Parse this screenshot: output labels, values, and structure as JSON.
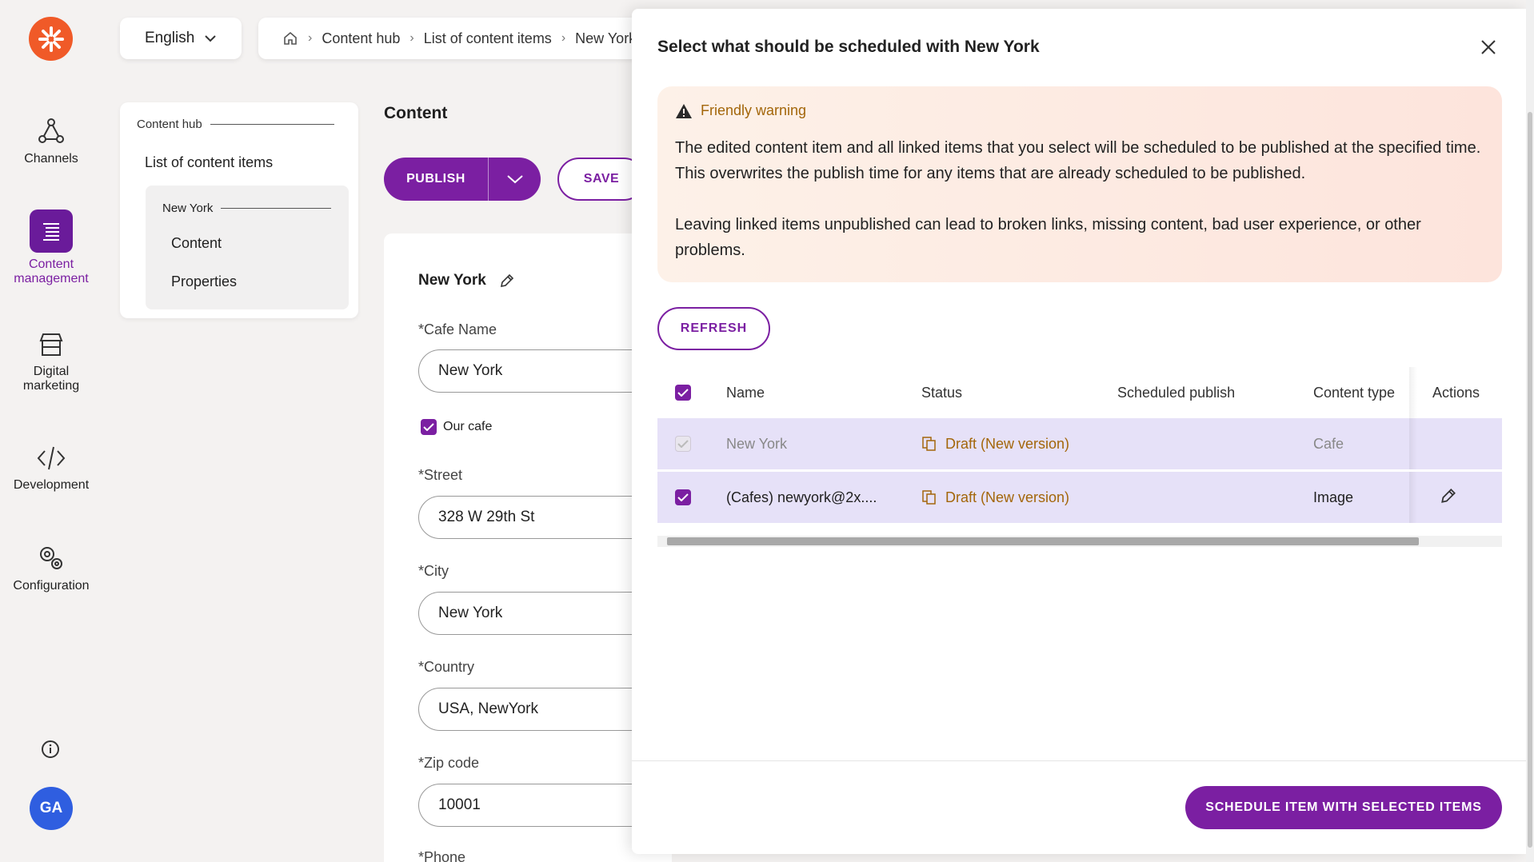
{
  "nav": {
    "items": [
      {
        "label": "Channels"
      },
      {
        "label": "Content management"
      },
      {
        "label": "Digital marketing"
      },
      {
        "label": "Development"
      },
      {
        "label": "Configuration"
      }
    ],
    "avatar": "GA"
  },
  "header": {
    "language": "English",
    "breadcrumb": [
      "Content hub",
      "List of content items",
      "New York"
    ]
  },
  "tree": {
    "hub": "Content hub",
    "list": "List of content items",
    "item": "New York",
    "children": [
      "Content",
      "Properties"
    ]
  },
  "main": {
    "title": "Content",
    "publish_label": "PUBLISH",
    "save_label": "SAVE",
    "item_title": "New York",
    "fields": {
      "cafe_name_label": "*Cafe Name",
      "cafe_name_value": "New York",
      "our_cafe_label": "Our cafe",
      "street_label": "*Street",
      "street_value": "328 W 29th St",
      "city_label": "*City",
      "city_value": "New York",
      "country_label": "*Country",
      "country_value": "USA, NewYork",
      "zip_label": "*Zip code",
      "zip_value": "10001",
      "phone_label": "*Phone"
    }
  },
  "modal": {
    "title": "Select what should be scheduled with New York",
    "warning_title": "Friendly warning",
    "warning_p1": "The edited content item and all linked items that you select will be scheduled to be published at the specified time. This overwrites the publish time for any items that are already scheduled to be published.",
    "warning_p2": "Leaving linked items unpublished can lead to broken links, missing content, bad user experience, or other problems.",
    "refresh_label": "REFRESH",
    "columns": {
      "name": "Name",
      "status": "Status",
      "scheduled": "Scheduled publish",
      "type": "Content type",
      "actions": "Actions"
    },
    "rows": [
      {
        "name": "New York",
        "status": "Draft (New version)",
        "type": "Cafe"
      },
      {
        "name": "(Cafes) newyork@2x....",
        "status": "Draft (New version)",
        "type": "Image"
      }
    ],
    "schedule_label": "SCHEDULE ITEM WITH SELECTED ITEMS"
  },
  "colors": {
    "accent": "#7b1fa2",
    "brand": "#f05a28",
    "warning": "#a3660a"
  }
}
